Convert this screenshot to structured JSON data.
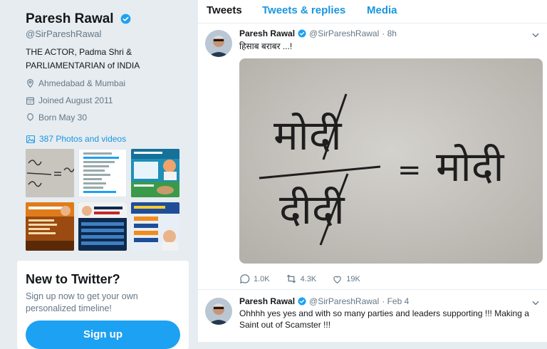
{
  "profile": {
    "name": "Paresh Rawal",
    "handle": "@SirPareshRawal",
    "bio_line1": "THE ACTOR, Padma Shri &",
    "bio_line2": "PARLIAMENTARIAN of INDIA",
    "location": "Ahmedabad & Mumbai",
    "joined": "Joined August 2011",
    "born": "Born May 30",
    "photos_link": "387 Photos and videos"
  },
  "signup_card": {
    "title": "New to Twitter?",
    "text": "Sign up now to get your own personalized timeline!",
    "button": "Sign up"
  },
  "tabs": [
    "Tweets",
    "Tweets & replies",
    "Media"
  ],
  "tweets": [
    {
      "name": "Paresh Rawal",
      "handle": "@SirPareshRawal",
      "time": "· 8h",
      "text": "हिसाब बराबर ...!",
      "image_text_top": "मोदी",
      "image_text_bottom": "दीदी",
      "image_text_right": "मोदी",
      "image_equals": "=",
      "replies": "1.0K",
      "retweets": "4.3K",
      "likes": "19K"
    },
    {
      "name": "Paresh Rawal",
      "handle": "@SirPareshRawal",
      "time": "· Feb 4",
      "text_line1": "Ohhhh yes yes and with so many parties and leaders supporting !!! Making a",
      "text_line2": "Saint out of Scamster !!!"
    }
  ],
  "colors": {
    "accent": "#1da1f2",
    "link": "#1b95e0",
    "muted": "#657786",
    "background": "#e6ecf0"
  }
}
